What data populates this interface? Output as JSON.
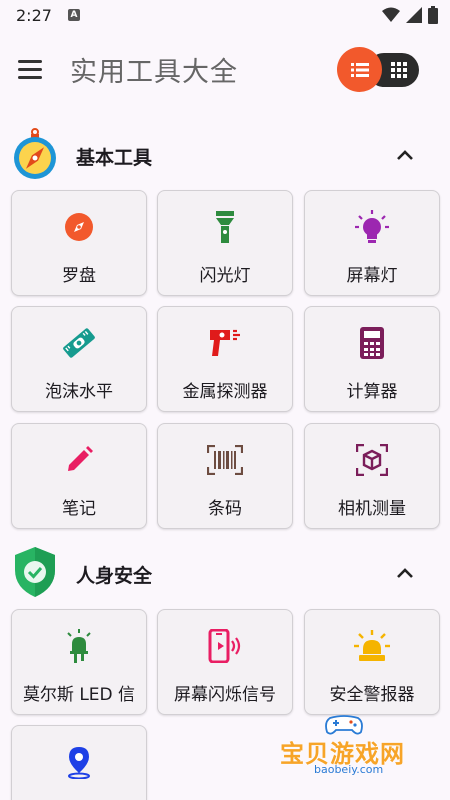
{
  "status_bar": {
    "time": "2:27",
    "notification_icon": "A"
  },
  "app_bar": {
    "title": "实用工具大全",
    "menu_icon": "hamburger-menu-icon",
    "list_view_icon": "list-icon",
    "grid_view_icon": "grid-icon",
    "accent_color": "#f2592c"
  },
  "sections": [
    {
      "title": "基本工具",
      "icon": "compass-icon",
      "tools": [
        {
          "label": "罗盘",
          "icon": "compass-icon",
          "color": "#f2592c"
        },
        {
          "label": "闪光灯",
          "icon": "flashlight-icon",
          "color": "#2e8b3e"
        },
        {
          "label": "屏幕灯",
          "icon": "lightbulb-icon",
          "color": "#9c27b0"
        },
        {
          "label": "泡沫水平",
          "icon": "level-icon",
          "color": "#169b8f"
        },
        {
          "label": "金属探测器",
          "icon": "metal-detector-icon",
          "color": "#e01b1b"
        },
        {
          "label": "计算器",
          "icon": "calculator-icon",
          "color": "#7b1e5a"
        },
        {
          "label": "笔记",
          "icon": "pencil-icon",
          "color": "#e91e63"
        },
        {
          "label": "条码",
          "icon": "barcode-icon",
          "color": "#6d4c41"
        },
        {
          "label": "相机测量",
          "icon": "camera-measure-icon",
          "color": "#7b1e5a"
        }
      ]
    },
    {
      "title": "人身安全",
      "icon": "shield-check-icon",
      "tools": [
        {
          "label": "莫尔斯 LED 信",
          "icon": "led-signal-icon",
          "color": "#2e8b3e"
        },
        {
          "label": "屏幕闪烁信号",
          "icon": "phone-signal-icon",
          "color": "#e91e63"
        },
        {
          "label": "安全警报器",
          "icon": "alarm-light-icon",
          "color": "#f5b400"
        },
        {
          "label": "",
          "icon": "location-pin-icon",
          "color": "#1e40e6"
        }
      ]
    }
  ],
  "watermark": {
    "text": "宝贝游戏网",
    "url": "baobeiy.com"
  }
}
